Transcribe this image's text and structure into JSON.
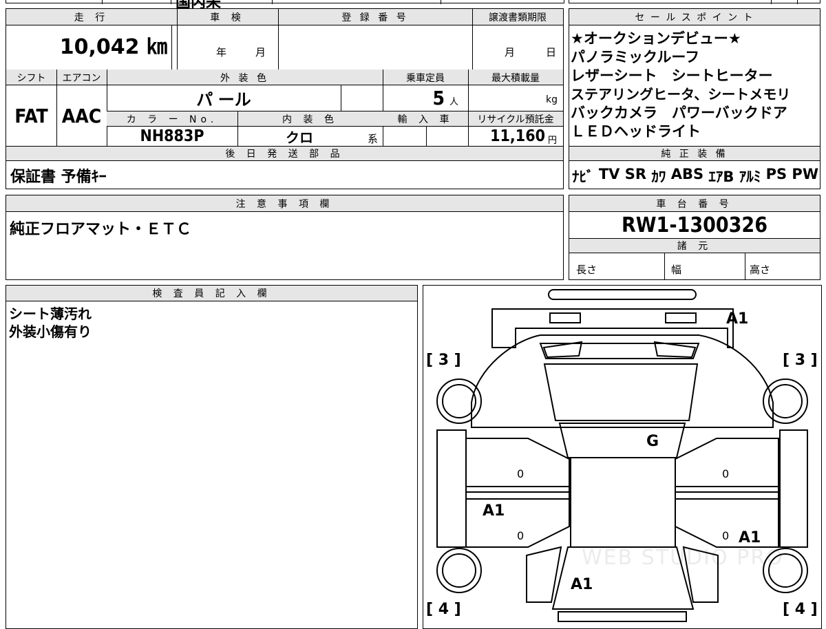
{
  "top_strip": {
    "partial_text": "国内未"
  },
  "basic": {
    "mileage_label": "走 行",
    "mileage_value": "10,042 ㎞",
    "inspection_label": "車 検",
    "inspection_year": "年",
    "inspection_month": "月",
    "registration_label": "登 録 番 号",
    "transfer_label": "譲渡書類期限",
    "transfer_month": "月",
    "transfer_day": "日",
    "shift_label": "シフト",
    "ac_label": "エアコン",
    "exterior_label": "外 装 色",
    "capacity_label": "乗車定員",
    "maxload_label": "最大積載量",
    "shift_value": "FAT",
    "ac_value": "AAC",
    "exterior_value": "パ ール",
    "capacity_value": "5",
    "capacity_unit": "人",
    "maxload_unit": "kg",
    "colorno_label": "カ ラ ー No.",
    "interior_label": "内 装 色",
    "import_label": "輸 入 車",
    "recycle_label": "リサイクル預託金",
    "colorno_value": "NH883P",
    "interior_value": "クロ",
    "interior_suffix": "系",
    "recycle_value": "11,160",
    "recycle_unit": "円",
    "later_parts_label": "後 日 発 送 部 品",
    "later_parts_value": "保証書 予備ｷｰ"
  },
  "sales": {
    "title": "セ ー ル ス ポ イ ン ト",
    "lines": [
      "★オークションデビュー★",
      "パノラミックルーフ",
      "レザーシート　シートヒーター",
      "ステアリングヒータ、シートメモリ",
      "バックカメラ　パワーバックドア",
      "ＬＥＤヘッドライト"
    ]
  },
  "equipment": {
    "title": "純 正 装 備",
    "items": [
      "ﾅﾋﾞ",
      "TV",
      "SR",
      "ｶﾜ",
      "ABS",
      "ｴｱB",
      "ｱﾙﾐ",
      "PS",
      "PW"
    ]
  },
  "notes": {
    "title": "注 意 事 項 欄",
    "value": "純正フロアマット・ＥＴＣ"
  },
  "chassis": {
    "title": "車 台 番 号",
    "value": "RW1-1300326",
    "spec_title": "諸 元",
    "length_label": "長さ",
    "width_label": "幅",
    "height_label": "高さ"
  },
  "inspector": {
    "title": "検 査 員 記 入 欄",
    "lines": [
      "シート薄汚れ",
      "外装小傷有り"
    ]
  },
  "diagram": {
    "marks": {
      "rear_top": "A1",
      "left_upper_bracket": "[ 3 ]",
      "right_upper_bracket": "[ 3 ]",
      "left_lower_bracket": "[ 4 ]",
      "right_lower_bracket": "[ 4 ]",
      "glass": "G",
      "left_door_mid": "A1",
      "right_door_low": "A1",
      "front_hood": "A1",
      "door_zero_1": "0",
      "door_zero_2": "0",
      "door_zero_3": "0",
      "door_zero_4": "0"
    },
    "watermark": "WEB STUDIO PRO"
  }
}
